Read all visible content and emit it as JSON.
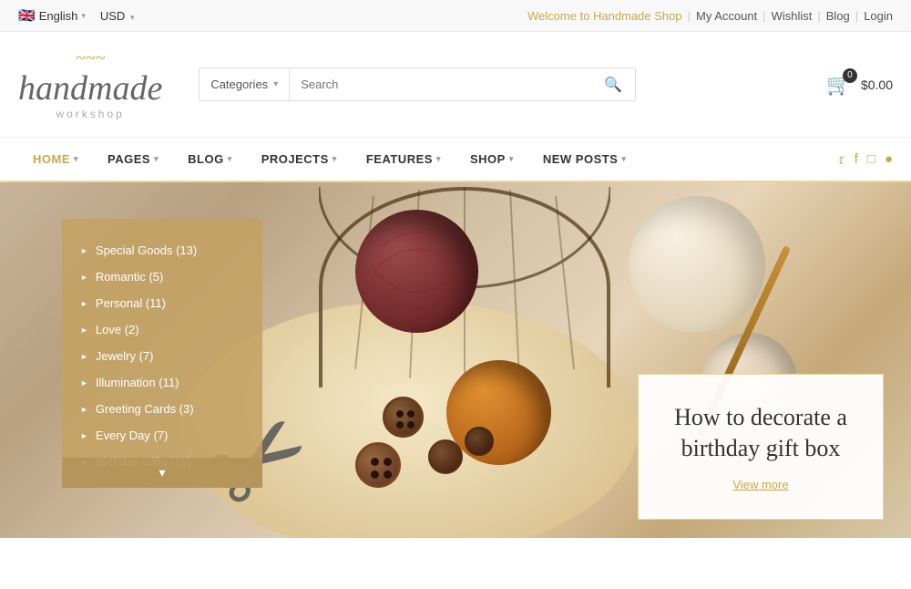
{
  "topbar": {
    "language": "English",
    "currency": "USD",
    "welcome": "Welcome to Handmade Shop",
    "links": [
      "My Account",
      "Wishlist",
      "Blog",
      "Login"
    ]
  },
  "header": {
    "logo_script": "handmade",
    "logo_sub": "workshop",
    "logo_decoration": "~~~",
    "search_placeholder": "Search",
    "categories_label": "Categories",
    "cart_count": "0",
    "cart_price": "$0.00"
  },
  "nav": {
    "items": [
      {
        "label": "HOME",
        "has_arrow": true,
        "active": true
      },
      {
        "label": "PAGES",
        "has_arrow": true,
        "active": false
      },
      {
        "label": "BLOG",
        "has_arrow": true,
        "active": false
      },
      {
        "label": "PROJECTS",
        "has_arrow": true,
        "active": false
      },
      {
        "label": "FEATURES",
        "has_arrow": true,
        "active": false
      },
      {
        "label": "SHOP",
        "has_arrow": true,
        "active": false
      },
      {
        "label": "NEW POSTS",
        "has_arrow": true,
        "active": false
      }
    ],
    "social": [
      "twitter",
      "facebook",
      "tumblr",
      "pinterest"
    ]
  },
  "sidebar": {
    "items": [
      {
        "label": "Special Goods (13)"
      },
      {
        "label": "Romantic (5)"
      },
      {
        "label": "Personal (11)"
      },
      {
        "label": "Love (2)"
      },
      {
        "label": "Jewelry (7)"
      },
      {
        "label": "Illumination (11)"
      },
      {
        "label": "Greeting Cards (3)"
      },
      {
        "label": "Every Day (7)"
      },
      {
        "label": "Birthday Gifts (15)"
      }
    ],
    "expand_icon": "▾"
  },
  "hero_card": {
    "title": "How to decorate a birthday gift box",
    "link_label": "View more"
  }
}
